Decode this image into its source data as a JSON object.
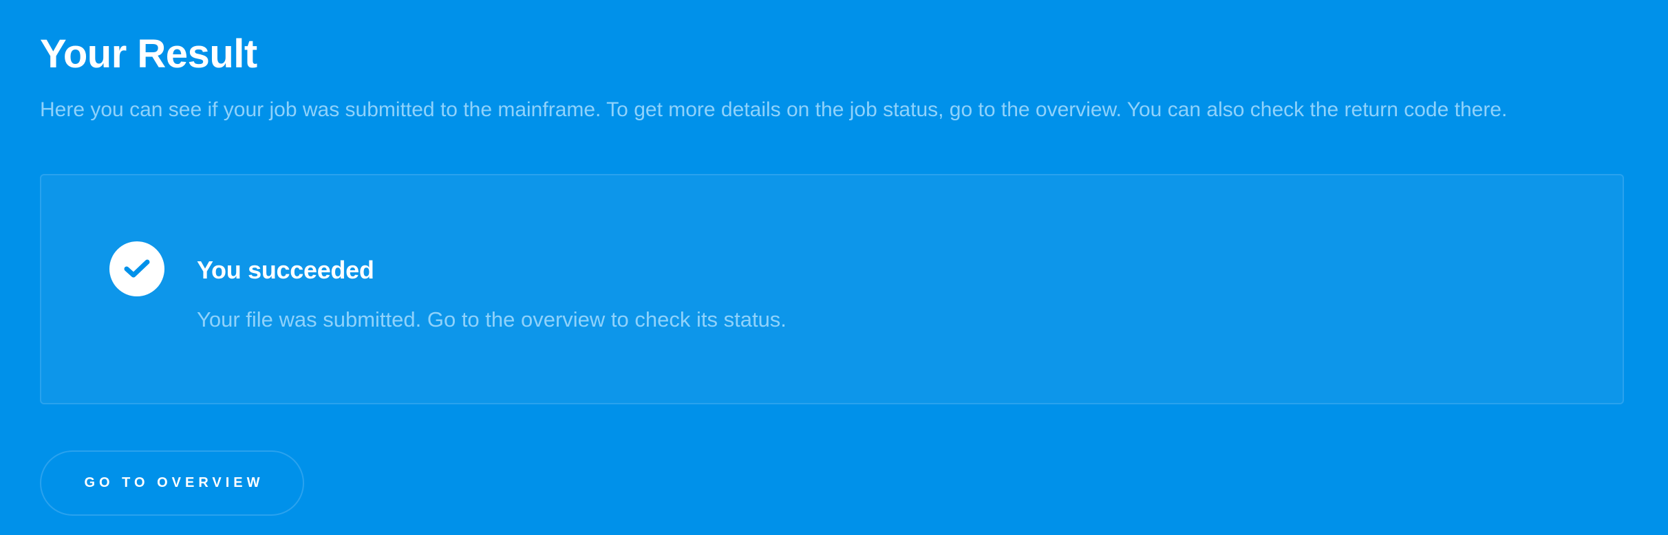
{
  "header": {
    "title": "Your Result",
    "description": "Here you can see if your job was submitted to the mainframe. To get more details on the job status, go to the overview. You can also check the return code there."
  },
  "result": {
    "status_icon": "check-icon",
    "title": "You succeeded",
    "message": "Your file was submitted. Go to the overview to check its status."
  },
  "actions": {
    "overview_label": "GO TO OVERVIEW"
  },
  "colors": {
    "background": "#0091ea",
    "card_background": "#0d96ea",
    "muted_text": "#8fd2fb",
    "check": "#0091ea"
  }
}
